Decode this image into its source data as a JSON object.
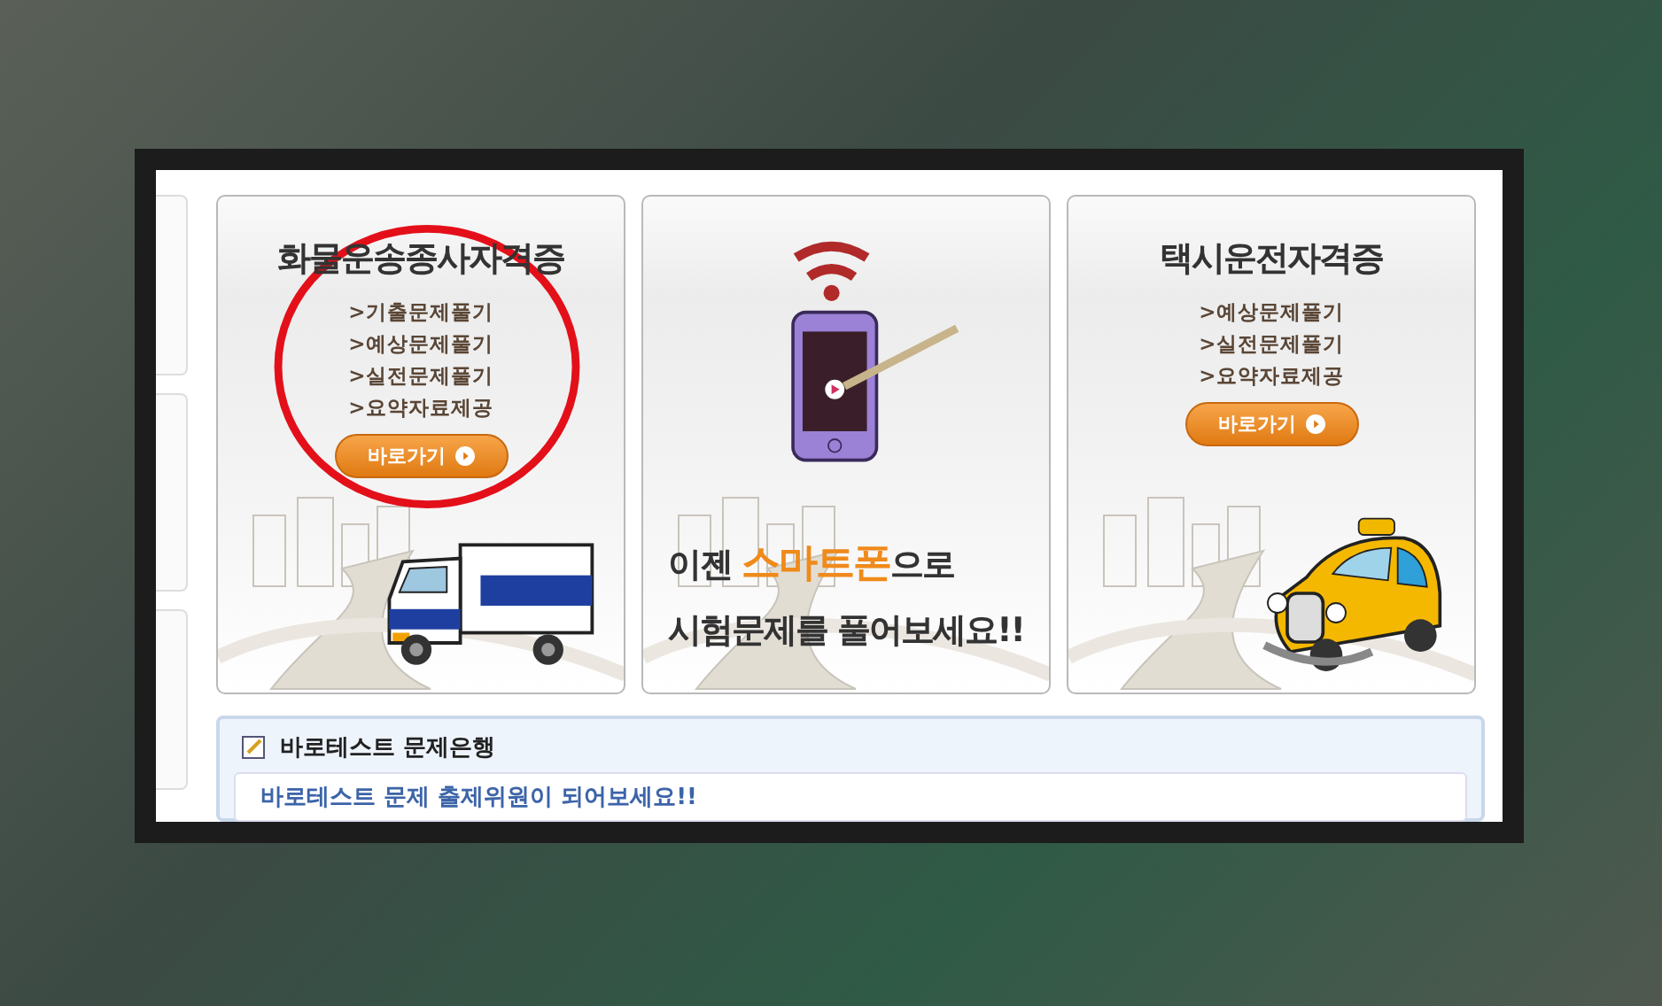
{
  "cards": [
    {
      "kind": "truck",
      "circled": true,
      "title": "화물운송종사자격증",
      "links": [
        ">기출문제풀기",
        ">예상문제풀기",
        ">실전문제풀기",
        ">요약자료제공"
      ],
      "button": "바로가기"
    },
    {
      "kind": "promo",
      "lines": [
        "이젠 **스마트폰**으로",
        "시험문제를 풀어보세요!!"
      ]
    },
    {
      "kind": "taxi",
      "circled": false,
      "title": "택시운전자격증",
      "links": [
        ">예상문제풀기",
        ">실전문제풀기",
        ">요약자료제공"
      ],
      "button": "바로가기"
    }
  ],
  "bank": {
    "title": "바로테스트 문제은행",
    "link": "바로테스트 문제 출제위원이 되어보세요!!"
  }
}
